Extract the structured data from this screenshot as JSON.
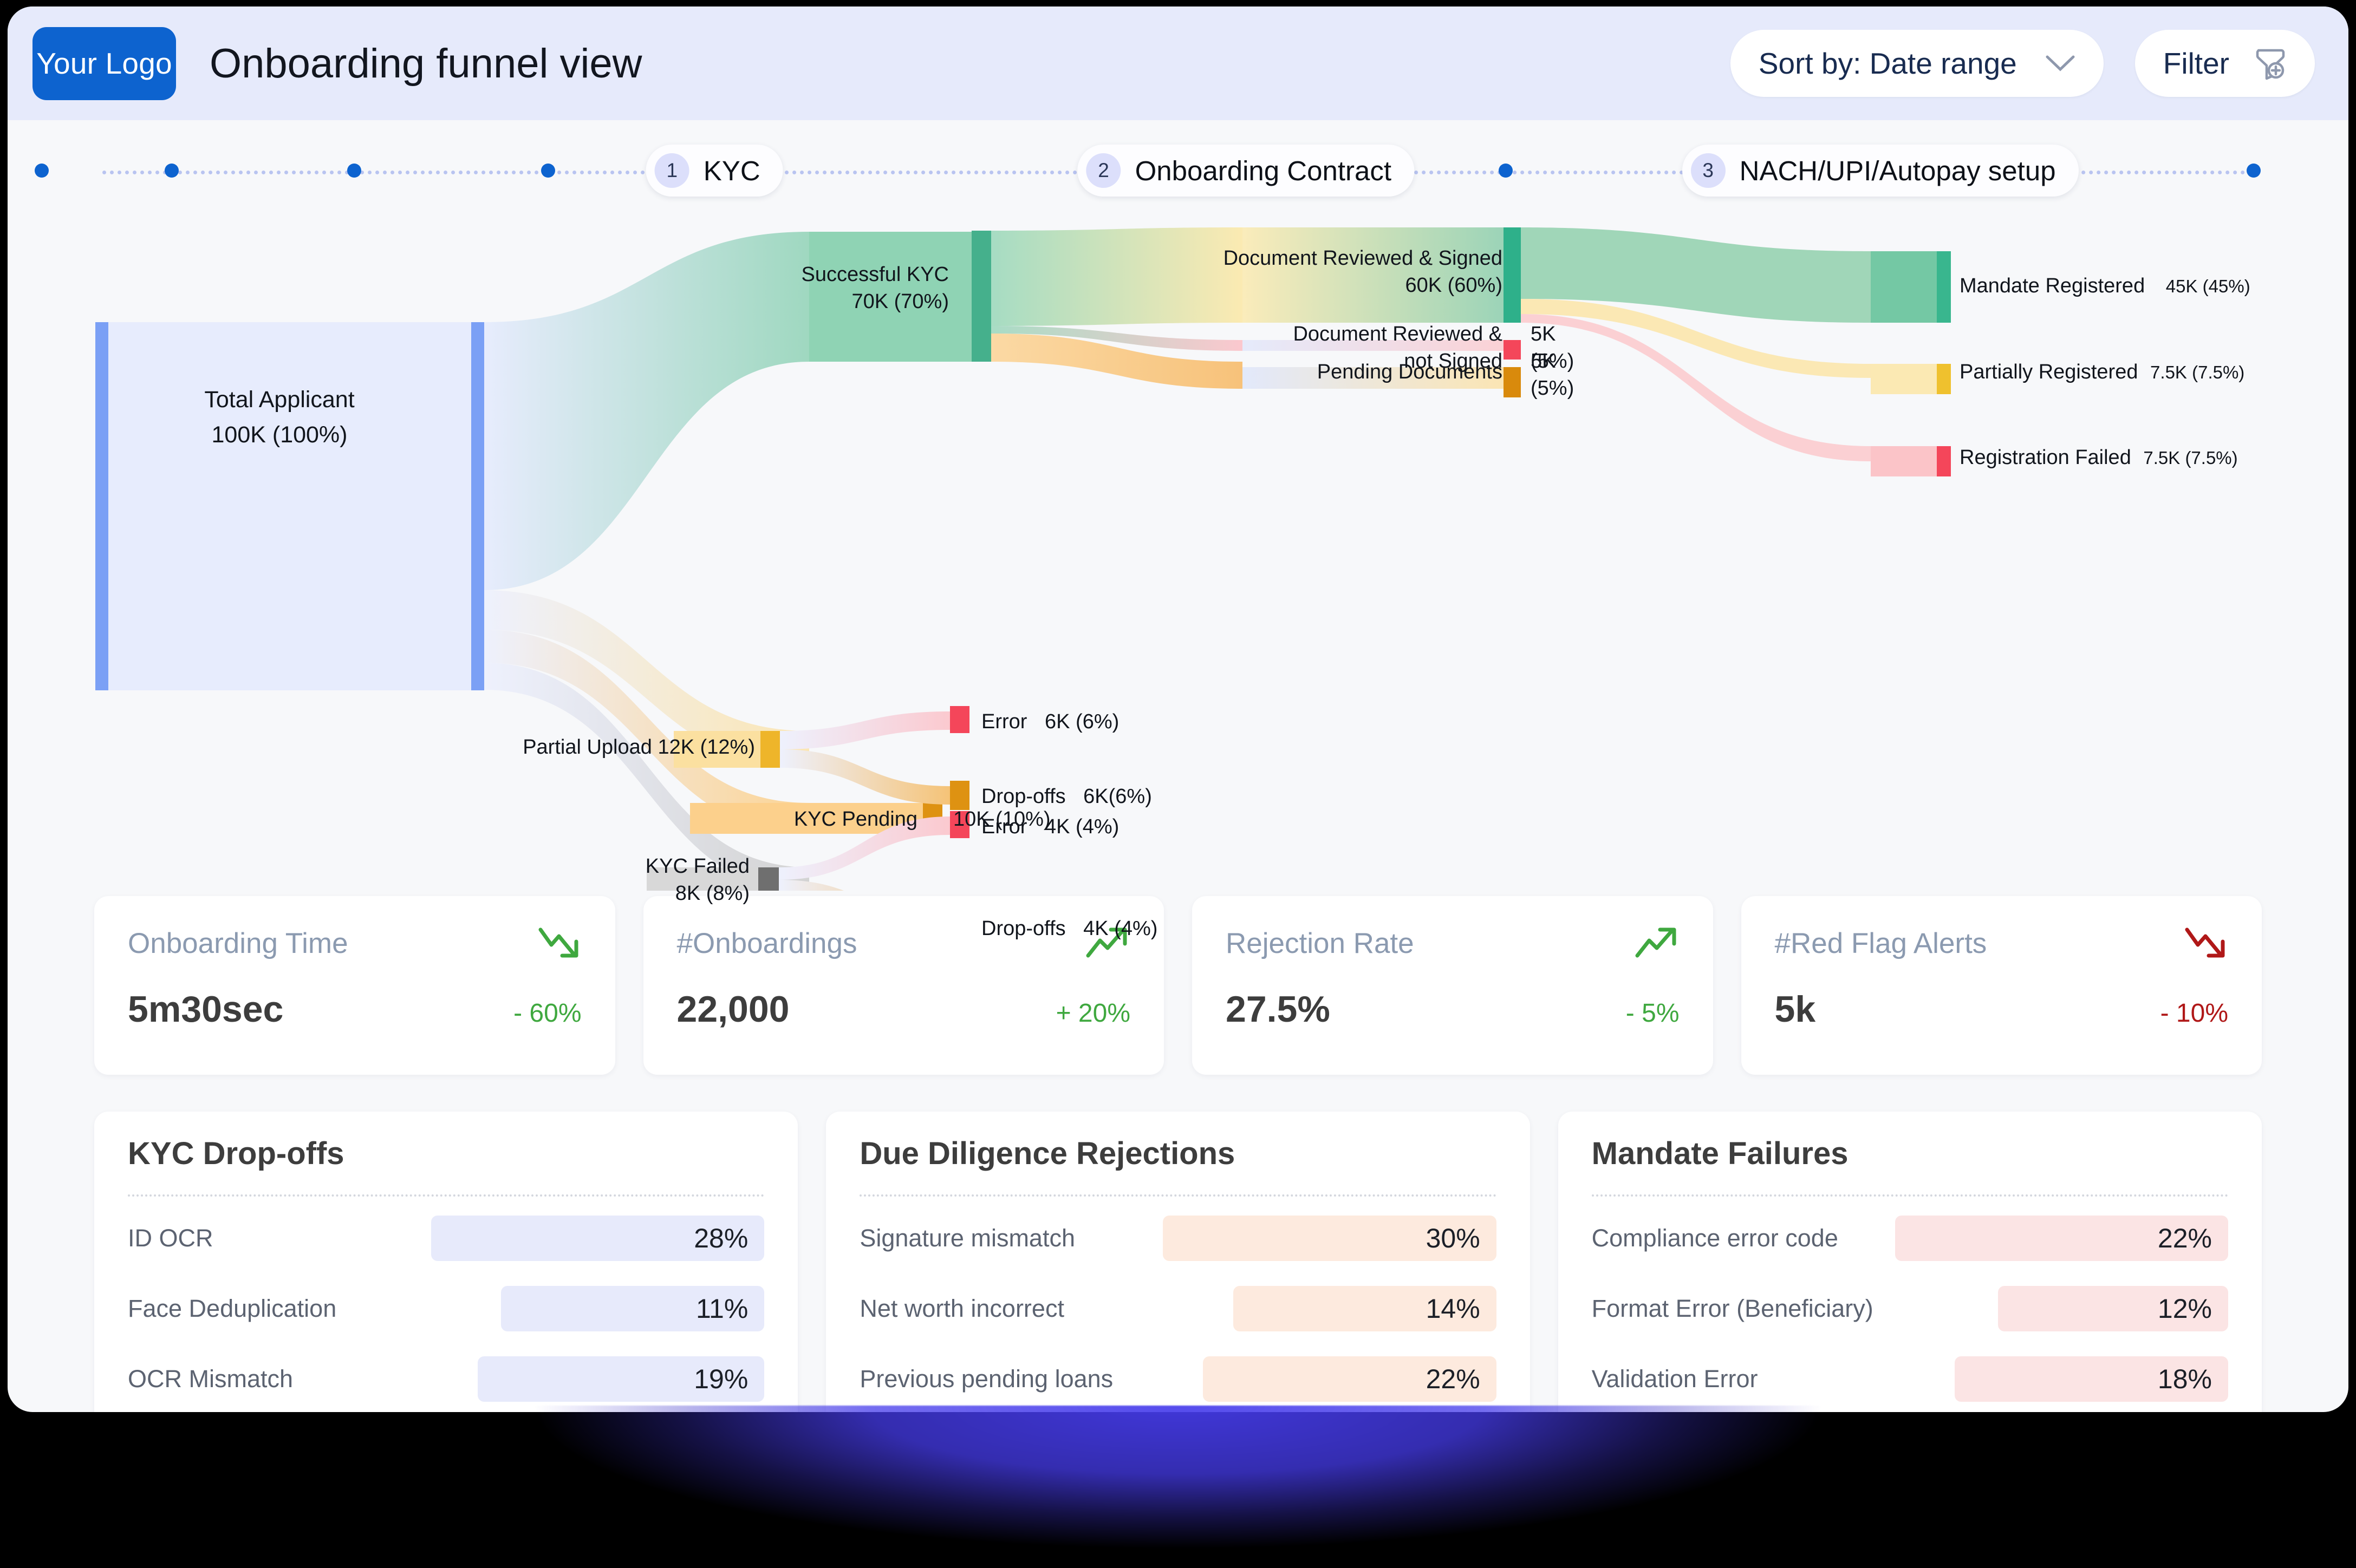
{
  "header": {
    "logo_label": "Your Logo",
    "title": "Onboarding funnel view",
    "sort_label": "Sort by: Date range",
    "filter_label": "Filter",
    "chevron_icon": "chevron-down-icon",
    "filter_icon": "filter-funnel-icon",
    "bg_color": "#e6eafb",
    "logo_color": "#0d63cf"
  },
  "stepper": {
    "steps": [
      {
        "num": "1",
        "label": "KYC",
        "x_pct": 30.2
      },
      {
        "num": "2",
        "label": "Onboarding Contract",
        "x_pct": 52.9
      },
      {
        "num": "3",
        "label": "NACH/UPI/Autopay setup",
        "x_pct": 80.0
      }
    ],
    "dots_x_pct": [
      1.45,
      7.0,
      14.8,
      23.1,
      64.0
    ],
    "dot_color": "#0d63cf",
    "line_color": "#b9c4f0"
  },
  "chart_data": {
    "type": "sankey",
    "title": "Onboarding funnel view",
    "total": "100K",
    "nodes": [
      {
        "id": "total",
        "label": "Total Applicant",
        "value": "100K",
        "pct": "100%",
        "value_label": "100K (100%)",
        "color": "#7ba0f5"
      },
      {
        "id": "kyc_success",
        "label": "Successful KYC",
        "value": "70K",
        "pct": "70%",
        "value_label": "70K (70%)",
        "color": "#45b08c"
      },
      {
        "id": "partial",
        "label": "Partial Upload",
        "value": "12K",
        "pct": "12%",
        "value_label": "12K (12%)",
        "color": "#eeb52a"
      },
      {
        "id": "kyc_pending",
        "label": "KYC Pending",
        "value": "10K",
        "pct": "10%",
        "value_label": "10K (10%)",
        "color": "#de9212"
      },
      {
        "id": "kyc_failed",
        "label": "KYC Failed",
        "value": "8K",
        "pct": "8%",
        "value_label": "8K (8%)",
        "color": "#6f6f6f"
      },
      {
        "id": "err_1",
        "label": "Error",
        "value": "6K",
        "pct": "6%",
        "value_label": "6K (6%)",
        "color": "#f4465a"
      },
      {
        "id": "drop_1",
        "label": "Drop-offs",
        "value": "6K",
        "pct": "6%",
        "value_label": "6K(6%)",
        "color": "#de9212"
      },
      {
        "id": "err_2",
        "label": "Error",
        "value": "4K",
        "pct": "4%",
        "value_label": "4K (4%)",
        "color": "#f4465a"
      },
      {
        "id": "drop_2",
        "label": "Drop-offs",
        "value": "4K",
        "pct": "4%",
        "value_label": "4K (4%)",
        "color": "#de9212"
      },
      {
        "id": "doc_signed",
        "label": "Document Reviewed & Signed",
        "value": "60K",
        "pct": "60%",
        "value_label": "60K (60%)",
        "color": "#2eb08a"
      },
      {
        "id": "doc_unsigned",
        "label": "Document Reviewed & not Signed",
        "value": "5K",
        "pct": "5%",
        "value_label": "5K (5%)",
        "color": "#f4465a"
      },
      {
        "id": "doc_pending",
        "label": "Pending Documents",
        "value": "5K",
        "pct": "5%",
        "value_label": "5K (5%)",
        "color": "#d98a0c"
      },
      {
        "id": "mandate_ok",
        "label": "Mandate Registered",
        "value": "45K",
        "pct": "45%",
        "value_label": "45K (45%)",
        "color": "#39b68e"
      },
      {
        "id": "mandate_part",
        "label": "Partially Registered",
        "value": "7.5K",
        "pct": "7.5%",
        "value_label": "7.5K (7.5%)",
        "color": "#efc12e"
      },
      {
        "id": "mandate_fail",
        "label": "Registration Failed",
        "value": "7.5K",
        "pct": "7.5%",
        "value_label": "7.5K (7.5%)",
        "color": "#f4465a"
      }
    ],
    "links": [
      {
        "source": "total",
        "target": "kyc_success",
        "value": 70
      },
      {
        "source": "total",
        "target": "partial",
        "value": 12
      },
      {
        "source": "total",
        "target": "kyc_pending",
        "value": 10
      },
      {
        "source": "total",
        "target": "kyc_failed",
        "value": 8
      },
      {
        "source": "partial",
        "target": "err_1",
        "value": 6
      },
      {
        "source": "partial",
        "target": "drop_1",
        "value": 6
      },
      {
        "source": "kyc_failed",
        "target": "err_2",
        "value": 4
      },
      {
        "source": "kyc_failed",
        "target": "drop_2",
        "value": 4
      },
      {
        "source": "kyc_success",
        "target": "doc_signed",
        "value": 60
      },
      {
        "source": "kyc_success",
        "target": "doc_unsigned",
        "value": 5
      },
      {
        "source": "kyc_success",
        "target": "doc_pending",
        "value": 5
      },
      {
        "source": "doc_signed",
        "target": "mandate_ok",
        "value": 45
      },
      {
        "source": "doc_signed",
        "target": "mandate_part",
        "value": 7.5
      },
      {
        "source": "doc_signed",
        "target": "mandate_fail",
        "value": 7.5
      }
    ]
  },
  "kpis": [
    {
      "name": "Onboarding Time",
      "value": "5m30sec",
      "delta": "- 60%",
      "dir": "down",
      "delta_tone": "good",
      "trend_icon": "trend-down-icon"
    },
    {
      "name": "#Onboardings",
      "value": "22,000",
      "delta": "+ 20%",
      "dir": "up",
      "delta_tone": "good",
      "trend_icon": "trend-up-icon"
    },
    {
      "name": "Rejection Rate",
      "value": "27.5%",
      "delta": "- 5%",
      "dir": "up",
      "delta_tone": "good",
      "trend_icon": "trend-up-icon"
    },
    {
      "name": "#Red Flag Alerts",
      "value": "5k",
      "delta": "- 10%",
      "dir": "down",
      "delta_tone": "bad",
      "trend_icon": "trend-down-icon"
    }
  ],
  "panels": [
    {
      "title": "KYC Drop-offs",
      "bar_color": "#e7eafb",
      "rows": [
        {
          "label": "ID OCR",
          "value": "28%",
          "bar_pct": 100
        },
        {
          "label": "Face Deduplication",
          "value": "11%",
          "bar_pct": 79
        },
        {
          "label": "OCR Mismatch",
          "value": "19%",
          "bar_pct": 86
        }
      ]
    },
    {
      "title": "Due Diligence Rejections",
      "bar_color": "#fdeade",
      "rows": [
        {
          "label": "Signature mismatch",
          "value": "30%",
          "bar_pct": 100
        },
        {
          "label": "Net worth incorrect",
          "value": "14%",
          "bar_pct": 79
        },
        {
          "label": "Previous pending loans",
          "value": "22%",
          "bar_pct": 88
        }
      ]
    },
    {
      "title": "Mandate Failures",
      "bar_color": "#fbe4e4",
      "rows": [
        {
          "label": "Compliance error code",
          "value": "22%",
          "bar_pct": 100
        },
        {
          "label": "Format Error (Beneficiary)",
          "value": "12%",
          "bar_pct": 69
        },
        {
          "label": "Validation Error",
          "value": "18%",
          "bar_pct": 82
        }
      ]
    }
  ]
}
